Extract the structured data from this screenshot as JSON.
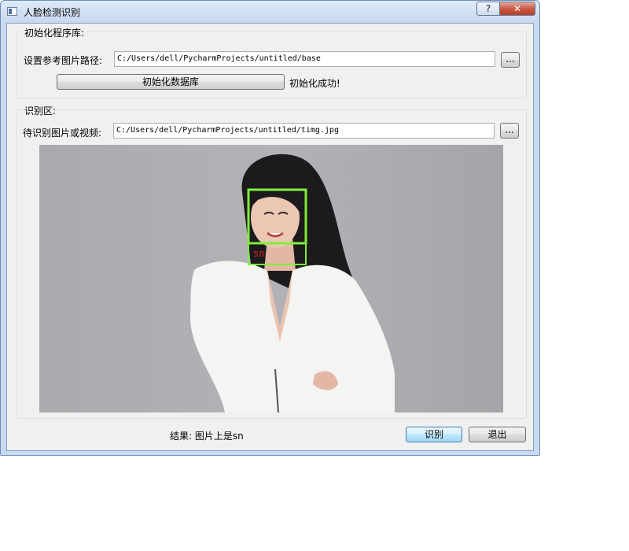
{
  "window": {
    "title": "人脸检测识别",
    "help_label": "?",
    "close_label": "✕"
  },
  "init_group": {
    "title": "初始化程序库:",
    "path_label": "设置参考图片路径:",
    "path_value": "C:/Users/dell/PycharmProjects/untitled/base",
    "browse_label": "...",
    "init_button": "初始化数据库",
    "init_status": "初始化成功!"
  },
  "recog_group": {
    "title": "识别区:",
    "path_label": "待识别图片或视频:",
    "path_value": "C:/Users/dell/PycharmProjects/untitled/timg.jpg",
    "browse_label": "...",
    "face_label": "sn"
  },
  "footer": {
    "result_text": "结果: 图片上是sn",
    "recognize_button": "识别",
    "exit_button": "退出"
  },
  "colors": {
    "face_box": "#7cf03c",
    "face_label": "#e02020",
    "accent": "#3c7fb1"
  }
}
